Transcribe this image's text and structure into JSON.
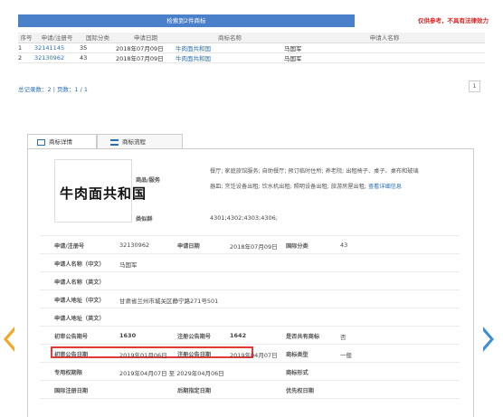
{
  "results": {
    "banner": "检索到2件商标",
    "disclaimer": "仅供参考，不具有法律效力",
    "headers": [
      "序号",
      "申请/注册号",
      "国际分类",
      "申请日期",
      "商标名称",
      "申请人名称"
    ],
    "rows": [
      [
        "1",
        "32141145",
        "35",
        "2018年07月09日",
        "牛肉面共和国",
        "马国军"
      ],
      [
        "2",
        "32130962",
        "43",
        "2018年07月09日",
        "牛肉面共和国",
        "马国军"
      ]
    ],
    "summary": "总记录数：2 | 页数：1 / 1",
    "page": "1"
  },
  "tabs": [
    "商标详情",
    "商标流程"
  ],
  "detail": {
    "mark_name": "牛肉面共和国",
    "goods_label": "商品/服务",
    "goods_line1": "餐厅; 家庭旅馆服务; 自助餐厅; 预订临时住所; 养老院; 出租椅子、桌子、桌布和玻璃",
    "goods_line2": "器皿; 烹饪设备出租; 饮水机出租; 照明设备出租; 旅游房屋出租;",
    "goods_more": "查看详细信息",
    "similar_label": "类似群",
    "similar_value": "4301;4302;4303;4306;",
    "fields": {
      "reg_no_label": "申请/注册号",
      "reg_no": "32130962",
      "app_date_label": "申请日期",
      "app_date": "2018年07月09日",
      "intl_class_label": "国际分类",
      "intl_class": "43",
      "applicant_cn_label": "申请人名称（中文）",
      "applicant_cn": "马国军",
      "applicant_en_label": "申请人名称（英文）",
      "address_cn_label": "申请人地址（中文）",
      "address_cn": "甘肃省兰州市城关区静宁路271号501",
      "address_en_label": "申请人地址（英文）",
      "prelim_no_label": "初审公告期号",
      "prelim_no": "1630",
      "reg_pub_no_label": "注册公告期号",
      "reg_pub_no": "1642",
      "shared_label": "是否共有商标",
      "shared": "否",
      "prelim_date_label": "初审公告日期",
      "prelim_date": "2019年01月06日",
      "reg_pub_date_label": "注册公告日期",
      "reg_pub_date": "2019年04月07日",
      "mark_type_label": "商标类型",
      "mark_type": "一般",
      "exclusive_label": "专用权期限",
      "exclusive": "2019年04月07日 至 2029年04月06日",
      "mark_form_label": "商标形式",
      "intl_reg_date_label": "国际注册日期",
      "later_date_label": "后期指定日期",
      "priority_date_label": "优先权日期"
    }
  },
  "colors": {
    "accent_blue": "#4a7fc9",
    "link": "#2a6fb5",
    "warning": "#e02020",
    "arrow_left": "#f5a623",
    "arrow_right": "#3d8fd6",
    "highlight": "#e53935"
  }
}
